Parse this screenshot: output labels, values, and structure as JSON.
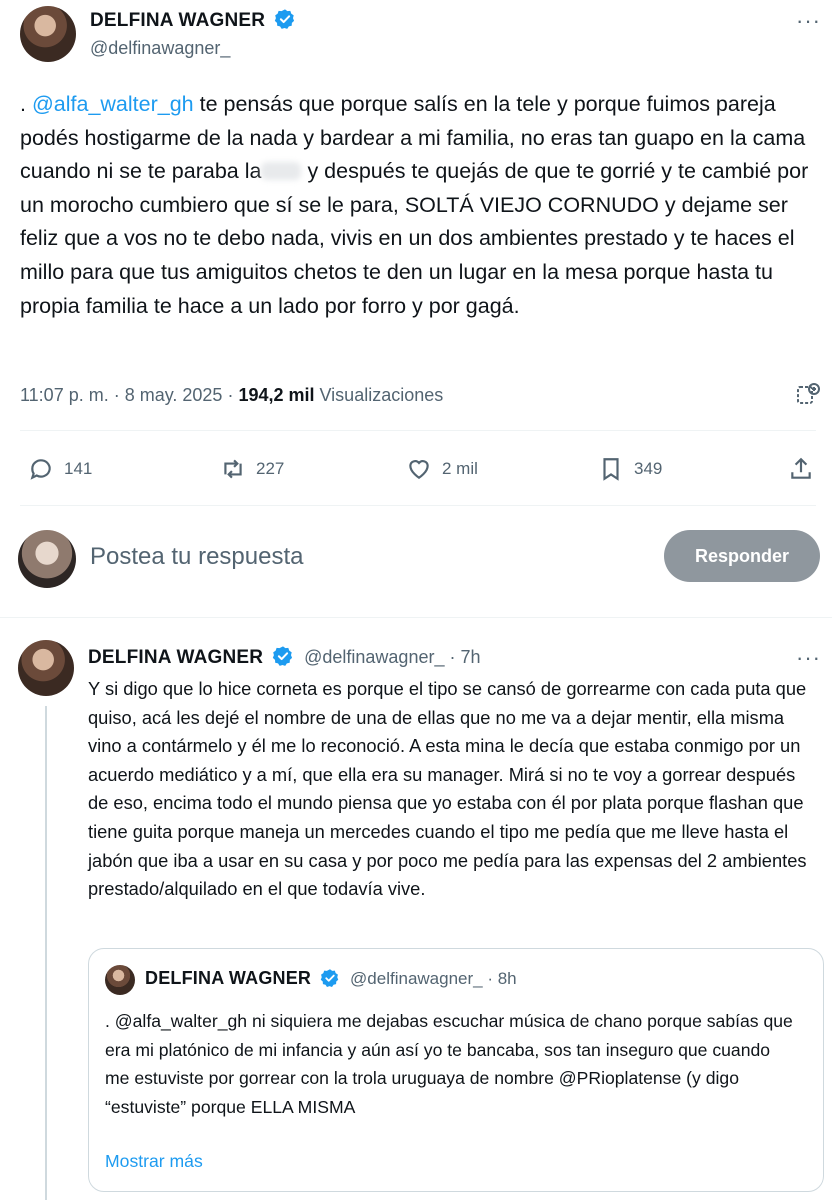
{
  "tweet": {
    "author_name": "DELFINA WAGNER",
    "author_handle": "@delfinawagner_",
    "text_prefix": ". ",
    "mention": "@alfa_walter_gh",
    "text_part1": " te pensás que porque salís en la tele y porque fuimos pareja podés hostigarme de la nada y bardear a mi familia, no eras tan guapo en la cama cuando ni se te paraba la",
    "text_part2": "y después te quejás de que te gorrié y te cambié por un morocho cumbiero que sí se le para, SOLTÁ VIEJO CORNUDO y dejame ser feliz que a vos no te debo nada, vivis en un dos ambientes prestado y te haces el millo para que tus amiguitos chetos te den un lugar en la mesa porque hasta tu propia familia te hace a un lado por forro y por gagá.",
    "time": "11:07 p. m. · 8 may. 2025 · ",
    "views_count": "194,2 mil",
    "views_label": " Visualizaciones",
    "actions": {
      "replies": "141",
      "retweets": "227",
      "likes": "2 mil",
      "bookmarks": "349"
    },
    "more_icon": "more-dots-icon",
    "verified_color": "#1d9bf0"
  },
  "composer": {
    "placeholder": "Postea tu respuesta",
    "button_label": "Responder"
  },
  "reply": {
    "author_name": "DELFINA WAGNER",
    "author_handle": "@delfinawagner_",
    "time": " · 7h",
    "text": "Y si digo que lo hice corneta es porque el tipo se cansó de gorrearme con cada puta que quiso, acá les dejé el nombre de una de ellas que no me va a dejar mentir, ella misma vino a contármelo y él me lo reconoció. A esta mina le decía que estaba conmigo por un acuerdo mediático y a mí, que ella era su manager. Mirá si no te voy a gorrear después de eso, encima todo el mundo piensa que yo estaba con él por plata porque flashan que tiene guita porque maneja un mercedes cuando el tipo me pedía que me lleve hasta el jabón que iba a usar en su casa y por poco me pedía para las expensas del 2 ambientes prestado/alquilado en el que todavía vive.",
    "quote": {
      "author_name": "DELFINA WAGNER",
      "author_handle": "@delfinawagner_",
      "time": " · 8h",
      "text": ". @alfa_walter_gh ni siquiera me dejabas escuchar música de chano porque sabías que era mi platónico de mi infancia y aún así yo te bancaba, sos tan inseguro que cuando me estuviste por gorrear con la trola uruguaya de nombre @PRioplatense  (y digo “estuviste” porque ELLA MISMA",
      "show_more": "Mostrar más"
    }
  }
}
